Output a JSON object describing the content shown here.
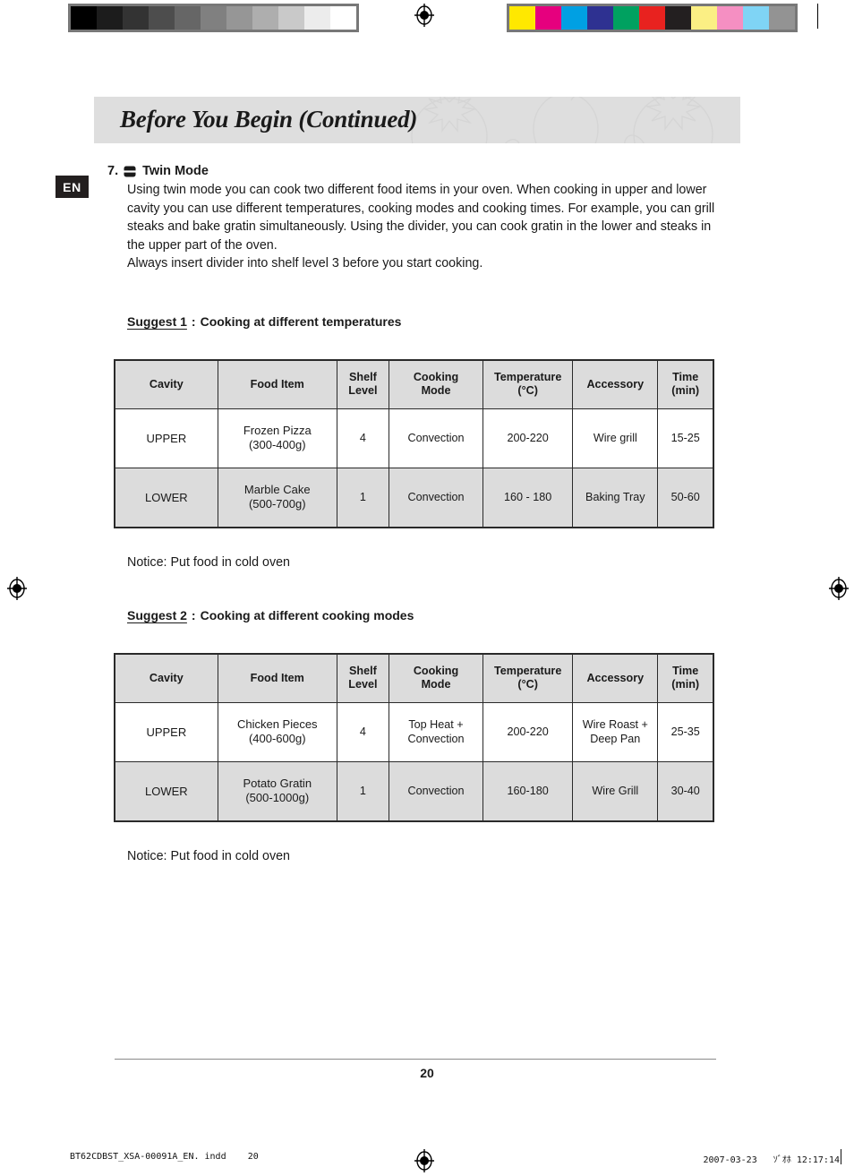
{
  "calibration": {
    "gray_strip_name": "grayscale-calibration-strip",
    "gray_values": [
      "#000000",
      "#1c1c1c",
      "#333333",
      "#4d4d4d",
      "#666666",
      "#808080",
      "#969696",
      "#aeaeae",
      "#c9c9c9",
      "#ececec",
      "#ffffff"
    ],
    "color_strip_name": "color-calibration-strip",
    "color_values": [
      "#ffe800",
      "#e6007e",
      "#00a0e3",
      "#2e3191",
      "#00a160",
      "#e8221f",
      "#231f20",
      "#fbef84",
      "#f58fc2",
      "#7fd4f5",
      "#939393"
    ]
  },
  "header": {
    "title": "Before You Begin (Continued)",
    "language_badge": "EN"
  },
  "section": {
    "number": "7.",
    "icon": "twin-mode-icon",
    "title": "Twin Mode",
    "paragraph": "Using twin mode you can cook two different food items in your oven. When cooking in upper and lower cavity you can use different temperatures, cooking modes and cooking times. For example, you can grill steaks and bake gratin simultaneously. Using the divider, you can cook gratin in the lower and steaks in the upper part of the oven.",
    "note_line": "Always insert divider into shelf level 3 before you start cooking."
  },
  "suggest1": {
    "label": "Suggest 1",
    "separator": ":",
    "caption": "Cooking at different temperatures",
    "notice": "Notice: Put food in cold oven",
    "table": {
      "headers": [
        "Cavity",
        "Food Item",
        "Shelf\nLevel",
        "Cooking\nMode",
        "Temperature\n(°C)",
        "Accessory",
        "Time\n(min)"
      ],
      "headers_split": [
        {
          "l1": "Cavity",
          "l2": ""
        },
        {
          "l1": "Food Item",
          "l2": ""
        },
        {
          "l1": "Shelf",
          "l2": "Level"
        },
        {
          "l1": "Cooking",
          "l2": "Mode"
        },
        {
          "l1": "Temperature",
          "l2": "(°C)"
        },
        {
          "l1": "Accessory",
          "l2": ""
        },
        {
          "l1": "Time",
          "l2": "(min)"
        }
      ],
      "rows": [
        {
          "cavity": "UPPER",
          "food_l1": "Frozen Pizza",
          "food_l2": "(300-400g)",
          "shelf": "4",
          "mode_l1": "Convection",
          "mode_l2": "",
          "temperature": "200-220",
          "accessory_l1": "Wire grill",
          "accessory_l2": "",
          "time": "15-25"
        },
        {
          "cavity": "LOWER",
          "food_l1": "Marble Cake",
          "food_l2": "(500-700g)",
          "shelf": "1",
          "mode_l1": "Convection",
          "mode_l2": "",
          "temperature": "160 - 180",
          "accessory_l1": "Baking Tray",
          "accessory_l2": "",
          "time": "50-60"
        }
      ]
    }
  },
  "suggest2": {
    "label": "Suggest 2",
    "separator": ":",
    "caption": "Cooking at different cooking modes",
    "notice": "Notice: Put food in cold oven",
    "table": {
      "headers_split": [
        {
          "l1": "Cavity",
          "l2": ""
        },
        {
          "l1": "Food Item",
          "l2": ""
        },
        {
          "l1": "Shelf",
          "l2": "Level"
        },
        {
          "l1": "Cooking",
          "l2": "Mode"
        },
        {
          "l1": "Temperature",
          "l2": "(°C)"
        },
        {
          "l1": "Accessory",
          "l2": ""
        },
        {
          "l1": "Time",
          "l2": "(min)"
        }
      ],
      "rows": [
        {
          "cavity": "UPPER",
          "food_l1": "Chicken Pieces",
          "food_l2": "(400-600g)",
          "shelf": "4",
          "mode_l1": "Top Heat +",
          "mode_l2": "Convection",
          "temperature": "200-220",
          "accessory_l1": "Wire Roast +",
          "accessory_l2": "Deep Pan",
          "time": "25-35"
        },
        {
          "cavity": "LOWER",
          "food_l1": "Potato Gratin",
          "food_l2": "(500-1000g)",
          "shelf": "1",
          "mode_l1": "Convection",
          "mode_l2": "",
          "temperature": "160-180",
          "accessory_l1": "Wire Grill",
          "accessory_l2": "",
          "time": "30-40"
        }
      ]
    }
  },
  "footer": {
    "page_number": "20",
    "file_name": "BT62CDBST_XSA-00091A_EN. indd",
    "file_page": "20",
    "print_date": "2007-03-23",
    "print_meridiem": "ｿﾞｵﾎ",
    "print_time": "12:17:14"
  }
}
